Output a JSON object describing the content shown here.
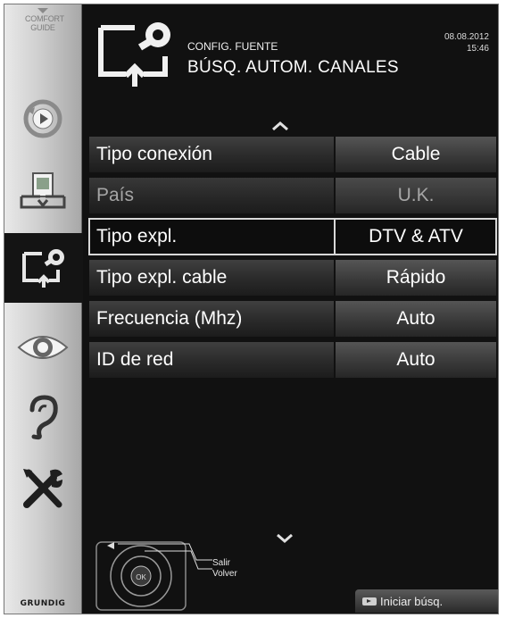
{
  "sidebar": {
    "comfort_guide": "COMFORT GUIDE",
    "items": [
      {
        "name": "source-icon"
      },
      {
        "name": "media-icon"
      },
      {
        "name": "source-config-icon",
        "active": true
      },
      {
        "name": "picture-icon"
      },
      {
        "name": "sound-icon"
      },
      {
        "name": "settings-icon"
      }
    ],
    "brand": "GRUNDIG"
  },
  "header": {
    "subtitle": "CONFIG. FUENTE",
    "title": "BÚSQ. AUTOM. CANALES",
    "date": "08.08.2012",
    "time": "15:46"
  },
  "menu": {
    "rows": [
      {
        "label": "Tipo conexión",
        "value": "Cable",
        "state": "normal"
      },
      {
        "label": "País",
        "value": "U.K.",
        "state": "disabled"
      },
      {
        "label": "Tipo expl.",
        "value": "DTV & ATV",
        "state": "selected"
      },
      {
        "label": "Tipo expl. cable",
        "value": "Rápido",
        "state": "normal"
      },
      {
        "label": "Frecuencia (Mhz)",
        "value": "Auto",
        "state": "normal"
      },
      {
        "label": "ID de red",
        "value": "Auto",
        "state": "normal"
      }
    ]
  },
  "footer": {
    "exit_label": "Salir",
    "back_label": "Volver",
    "ok_label": "OK",
    "start_label": "Iniciar búsq."
  },
  "colors": {
    "background": "#111111",
    "sidebar": "#cfcfcf",
    "selected_outline": "#d8d8d8"
  }
}
